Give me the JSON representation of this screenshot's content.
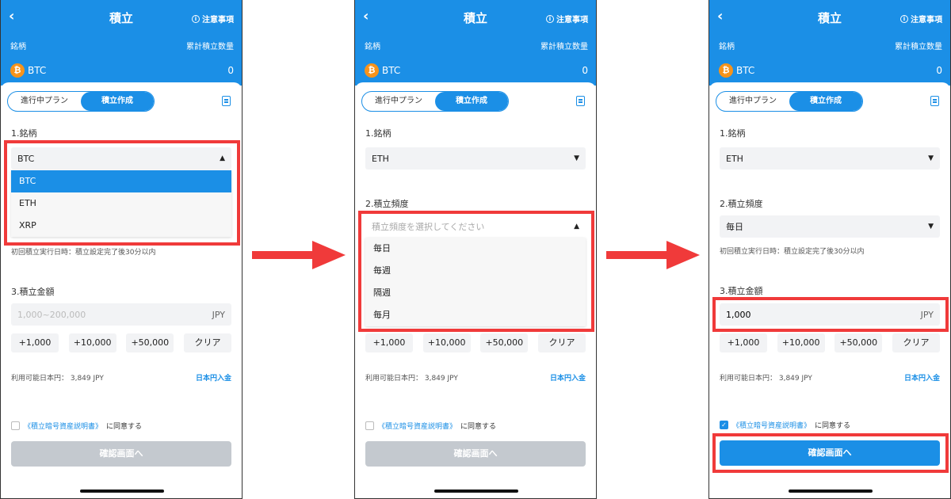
{
  "common": {
    "back_glyph": "‹",
    "title": "積立",
    "notice": "注意事項",
    "label_coin": "銘柄",
    "label_total": "累計積立数量",
    "coin": "BTC",
    "total": "0",
    "seg_running": "進行中プラン",
    "seg_create": "積立作成",
    "sec_coin": "1.銘柄",
    "sec_freq": "2.積立頻度",
    "sec_amount": "3.積立金額",
    "first_exec": "初回積立実行日時：積立設定完了後30分以内",
    "amount_placeholder": "1,000~200,000",
    "unit": "JPY",
    "quick": [
      "+1,000",
      "+10,000",
      "+50,000",
      "クリア"
    ],
    "avail_label": "利用可能日本円：  3,849 JPY",
    "deposit_link": "日本円入金",
    "agree_link": "《積立暗号資産説明書》",
    "agree_text": "に同意する",
    "confirm": "確認画面へ"
  },
  "screen1": {
    "selected_coin": "BTC",
    "dropdown": [
      "BTC",
      "ETH",
      "XRP"
    ]
  },
  "screen2": {
    "selected_coin": "ETH",
    "freq_placeholder": "積立頻度を選択してください",
    "dropdown": [
      "毎日",
      "毎週",
      "隔週",
      "毎月"
    ]
  },
  "screen3": {
    "selected_coin": "ETH",
    "selected_freq": "毎日",
    "amount": "1,000"
  },
  "colors": {
    "primary": "#1b8fe6",
    "highlight": "#f03a3a",
    "disabled": "#c4c9cf"
  }
}
